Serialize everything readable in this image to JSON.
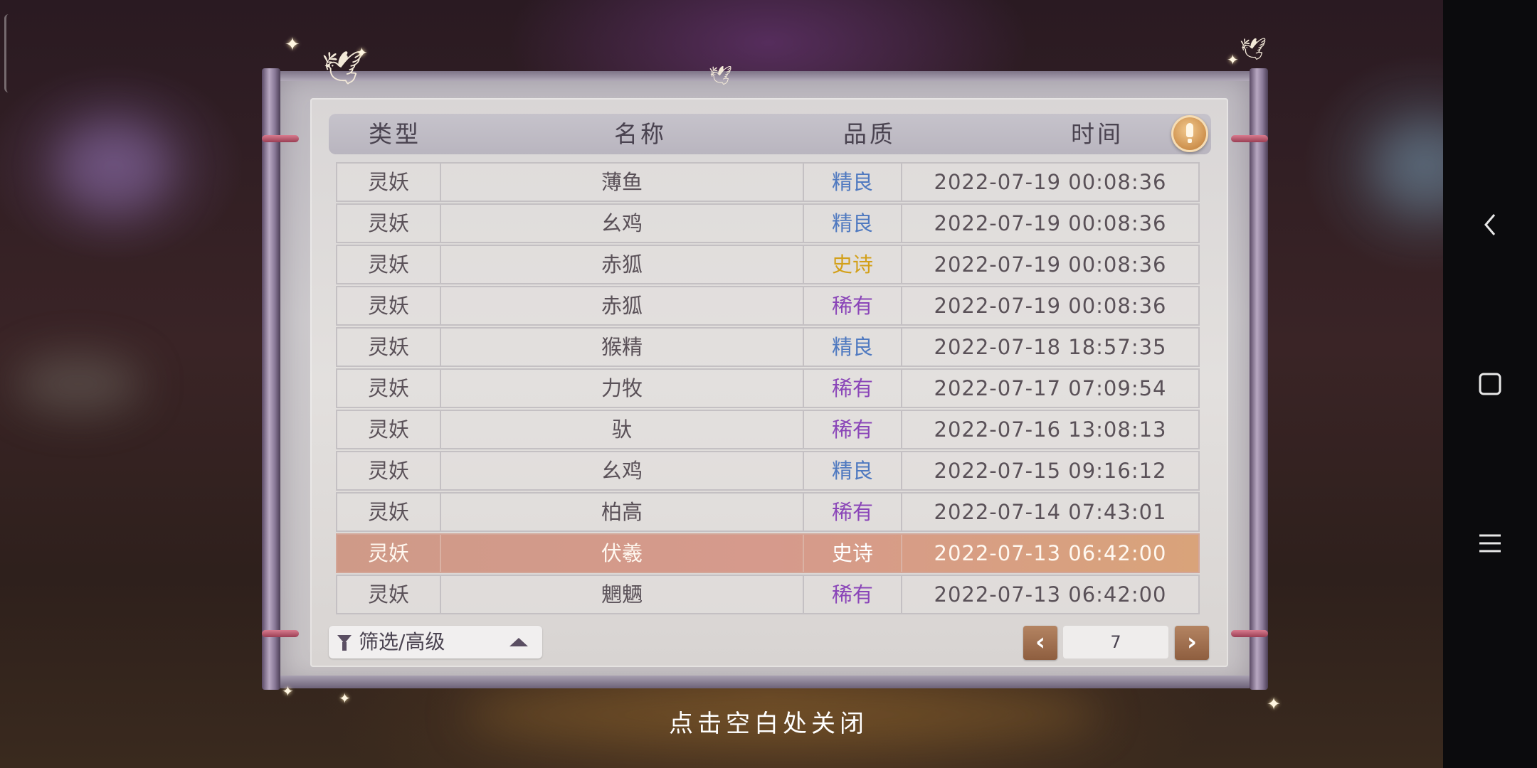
{
  "header": {
    "type_label": "类型",
    "name_label": "名称",
    "quality_label": "品质",
    "time_label": "时间"
  },
  "colors": {
    "quality_rare_blue": "#4f79c0",
    "quality_epic_gold": "#d3a019",
    "quality_rare_purple": "#8a45b8",
    "highlight_row": "#d69a8c"
  },
  "rows": [
    {
      "type": "灵妖",
      "name": "薄鱼",
      "quality": "精良",
      "quality_color": "#4f79c0",
      "time": "2022-07-19  00:08:36"
    },
    {
      "type": "灵妖",
      "name": "幺鸡",
      "quality": "精良",
      "quality_color": "#4f79c0",
      "time": "2022-07-19  00:08:36"
    },
    {
      "type": "灵妖",
      "name": "赤狐",
      "quality": "史诗",
      "quality_color": "#d3a019",
      "time": "2022-07-19  00:08:36"
    },
    {
      "type": "灵妖",
      "name": "赤狐",
      "quality": "稀有",
      "quality_color": "#8a45b8",
      "time": "2022-07-19  00:08:36"
    },
    {
      "type": "灵妖",
      "name": "猴精",
      "quality": "精良",
      "quality_color": "#4f79c0",
      "time": "2022-07-18  18:57:35"
    },
    {
      "type": "灵妖",
      "name": "力牧",
      "quality": "稀有",
      "quality_color": "#8a45b8",
      "time": "2022-07-17  07:09:54"
    },
    {
      "type": "灵妖",
      "name": "驮",
      "quality": "稀有",
      "quality_color": "#8a45b8",
      "time": "2022-07-16  13:08:13"
    },
    {
      "type": "灵妖",
      "name": "幺鸡",
      "quality": "精良",
      "quality_color": "#4f79c0",
      "time": "2022-07-15  09:16:12"
    },
    {
      "type": "灵妖",
      "name": "柏高",
      "quality": "稀有",
      "quality_color": "#8a45b8",
      "time": "2022-07-14  07:43:01"
    },
    {
      "type": "灵妖",
      "name": "伏羲",
      "quality": "史诗",
      "quality_color": "#ffffff",
      "time": "2022-07-13  06:42:00",
      "highlight": true
    },
    {
      "type": "灵妖",
      "name": "魍魉",
      "quality": "稀有",
      "quality_color": "#8a45b8",
      "time": "2022-07-13  06:42:00"
    }
  ],
  "footer": {
    "filter_label": "筛选/高级",
    "page_number": "7",
    "prev_icon": "chevron-left-icon",
    "next_icon": "chevron-right-icon"
  },
  "close_hint": "点击空白处关闭",
  "system_nav": {
    "back_icon": "back-icon",
    "home_icon": "home-icon",
    "menu_icon": "menu-icon"
  }
}
